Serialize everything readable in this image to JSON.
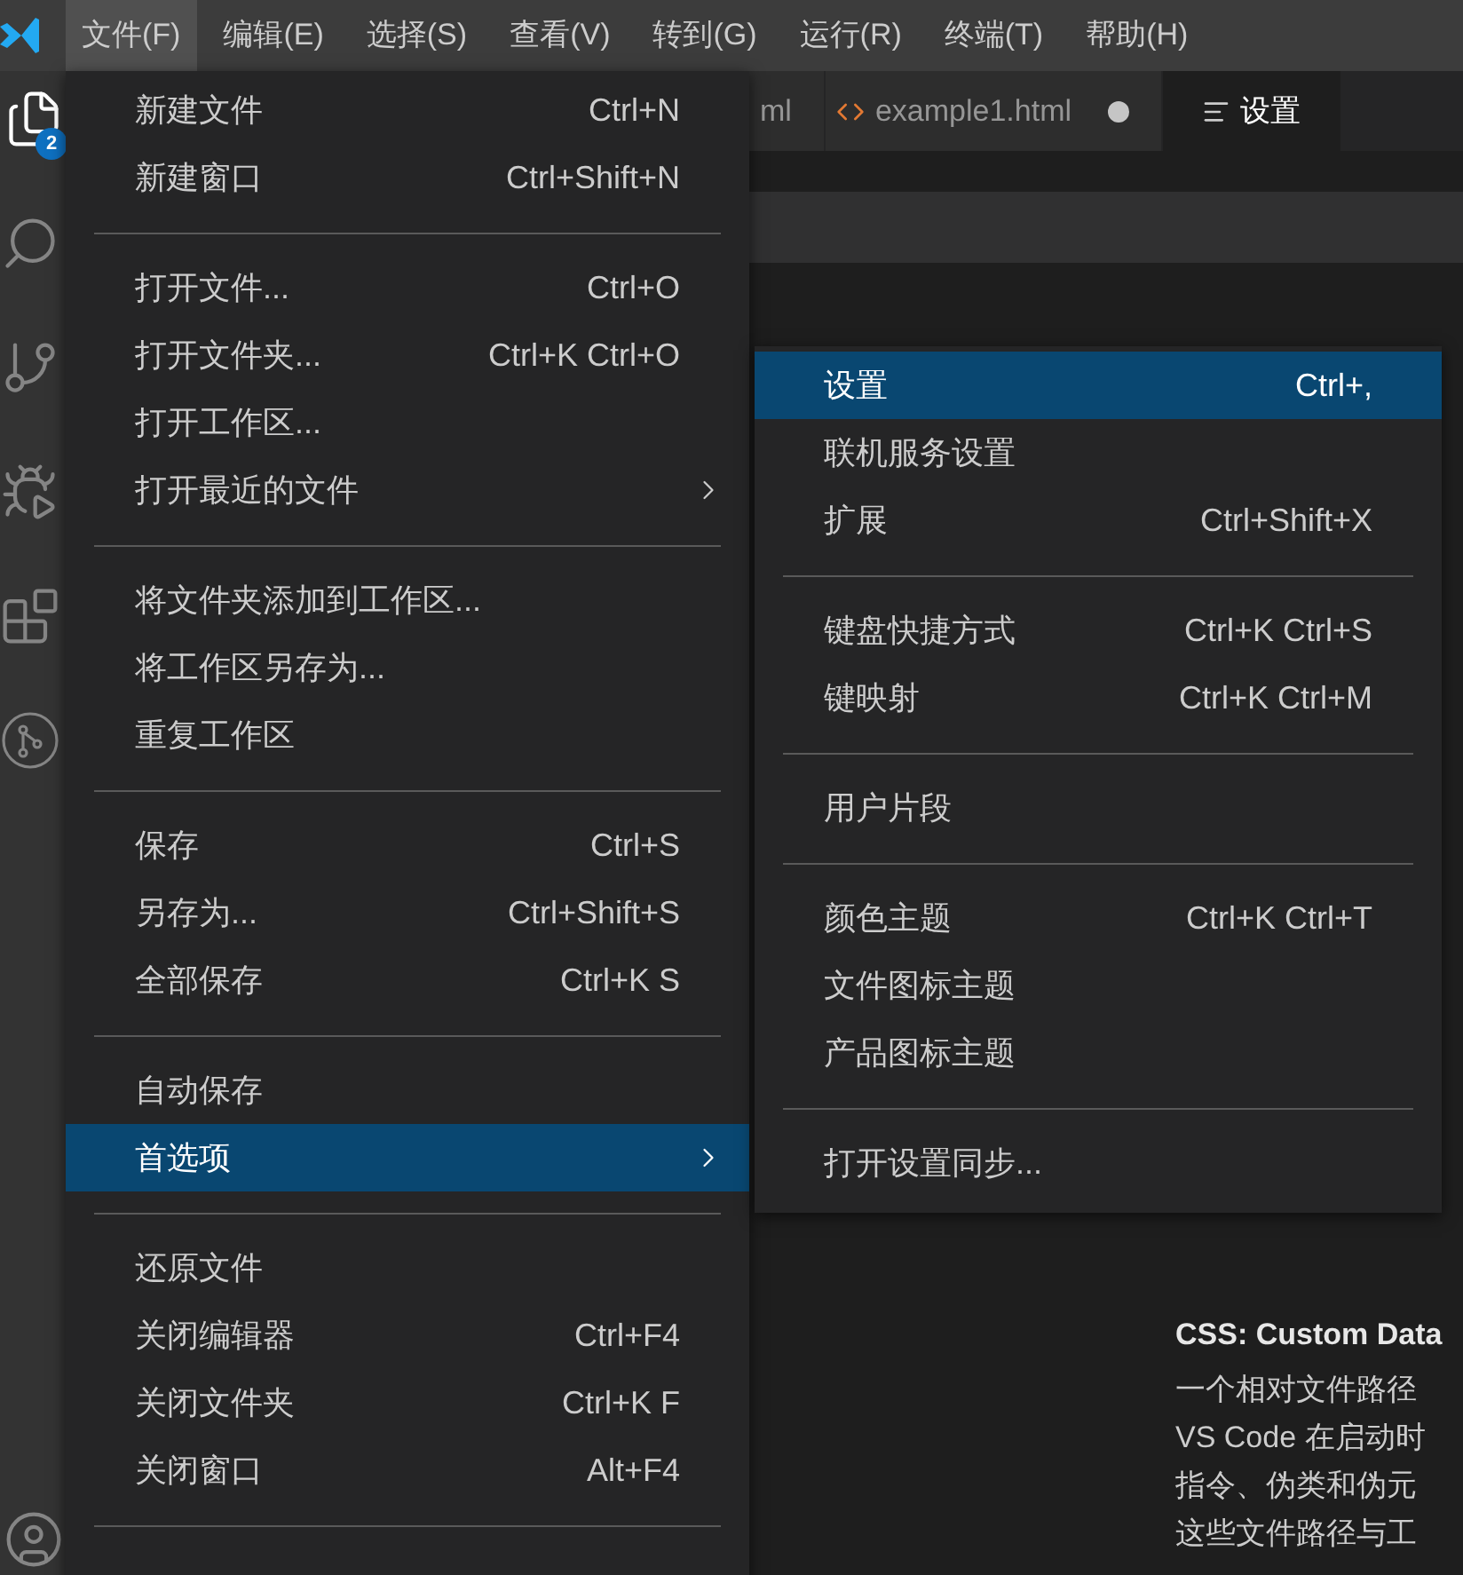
{
  "menubar": {
    "items": [
      {
        "label": "文件(F)",
        "selected": true
      },
      {
        "label": "编辑(E)",
        "selected": false
      },
      {
        "label": "选择(S)",
        "selected": false
      },
      {
        "label": "查看(V)",
        "selected": false
      },
      {
        "label": "转到(G)",
        "selected": false
      },
      {
        "label": "运行(R)",
        "selected": false
      },
      {
        "label": "终端(T)",
        "selected": false
      },
      {
        "label": "帮助(H)",
        "selected": false
      }
    ]
  },
  "activity_bar": {
    "badge": "2"
  },
  "tabs": [
    {
      "label": "ml",
      "kind": "plain",
      "selected": false,
      "modified": false
    },
    {
      "label": "example1.html",
      "kind": "html",
      "selected": false,
      "modified": true
    },
    {
      "label": "设置",
      "kind": "settings",
      "selected": true,
      "modified": false
    }
  ],
  "settings_content": {
    "heading": "CSS: Custom Data",
    "lines": [
      "一个相对文件路径",
      "VS Code 在启动时",
      "指令、伪类和伪元",
      "这些文件路径与工"
    ]
  },
  "file_menu": {
    "items": [
      {
        "kind": "item",
        "label": "新建文件",
        "shortcut": "Ctrl+N",
        "submenu": false,
        "selected": false
      },
      {
        "kind": "item",
        "label": "新建窗口",
        "shortcut": "Ctrl+Shift+N",
        "submenu": false,
        "selected": false
      },
      {
        "kind": "separator"
      },
      {
        "kind": "item",
        "label": "打开文件...",
        "shortcut": "Ctrl+O",
        "submenu": false,
        "selected": false
      },
      {
        "kind": "item",
        "label": "打开文件夹...",
        "shortcut": "Ctrl+K Ctrl+O",
        "submenu": false,
        "selected": false
      },
      {
        "kind": "item",
        "label": "打开工作区...",
        "submenu": false,
        "selected": false
      },
      {
        "kind": "item",
        "label": "打开最近的文件",
        "submenu": true,
        "selected": false
      },
      {
        "kind": "separator"
      },
      {
        "kind": "item",
        "label": "将文件夹添加到工作区...",
        "submenu": false,
        "selected": false
      },
      {
        "kind": "item",
        "label": "将工作区另存为...",
        "submenu": false,
        "selected": false
      },
      {
        "kind": "item",
        "label": "重复工作区",
        "submenu": false,
        "selected": false
      },
      {
        "kind": "separator"
      },
      {
        "kind": "item",
        "label": "保存",
        "shortcut": "Ctrl+S",
        "submenu": false,
        "selected": false
      },
      {
        "kind": "item",
        "label": "另存为...",
        "shortcut": "Ctrl+Shift+S",
        "submenu": false,
        "selected": false
      },
      {
        "kind": "item",
        "label": "全部保存",
        "shortcut": "Ctrl+K S",
        "submenu": false,
        "selected": false
      },
      {
        "kind": "separator"
      },
      {
        "kind": "item",
        "label": "自动保存",
        "submenu": false,
        "selected": false
      },
      {
        "kind": "item",
        "label": "首选项",
        "submenu": true,
        "selected": true
      },
      {
        "kind": "separator"
      },
      {
        "kind": "item",
        "label": "还原文件",
        "submenu": false,
        "selected": false
      },
      {
        "kind": "item",
        "label": "关闭编辑器",
        "shortcut": "Ctrl+F4",
        "submenu": false,
        "selected": false
      },
      {
        "kind": "item",
        "label": "关闭文件夹",
        "shortcut": "Ctrl+K F",
        "submenu": false,
        "selected": false
      },
      {
        "kind": "item",
        "label": "关闭窗口",
        "shortcut": "Alt+F4",
        "submenu": false,
        "selected": false
      },
      {
        "kind": "separator"
      }
    ]
  },
  "preferences_submenu": {
    "items": [
      {
        "kind": "item",
        "label": "设置",
        "shortcut": "Ctrl+,",
        "submenu": false,
        "selected": true
      },
      {
        "kind": "item",
        "label": "联机服务设置",
        "submenu": false,
        "selected": false
      },
      {
        "kind": "item",
        "label": "扩展",
        "shortcut": "Ctrl+Shift+X",
        "submenu": false,
        "selected": false
      },
      {
        "kind": "separator"
      },
      {
        "kind": "item",
        "label": "键盘快捷方式",
        "shortcut": "Ctrl+K Ctrl+S",
        "submenu": false,
        "selected": false
      },
      {
        "kind": "item",
        "label": "键映射",
        "shortcut": "Ctrl+K Ctrl+M",
        "submenu": false,
        "selected": false
      },
      {
        "kind": "separator"
      },
      {
        "kind": "item",
        "label": "用户片段",
        "submenu": false,
        "selected": false
      },
      {
        "kind": "separator"
      },
      {
        "kind": "item",
        "label": "颜色主题",
        "shortcut": "Ctrl+K Ctrl+T",
        "submenu": false,
        "selected": false
      },
      {
        "kind": "item",
        "label": "文件图标主题",
        "submenu": false,
        "selected": false
      },
      {
        "kind": "item",
        "label": "产品图标主题",
        "submenu": false,
        "selected": false
      },
      {
        "kind": "separator"
      },
      {
        "kind": "item",
        "label": "打开设置同步...",
        "submenu": false,
        "selected": false
      }
    ]
  }
}
